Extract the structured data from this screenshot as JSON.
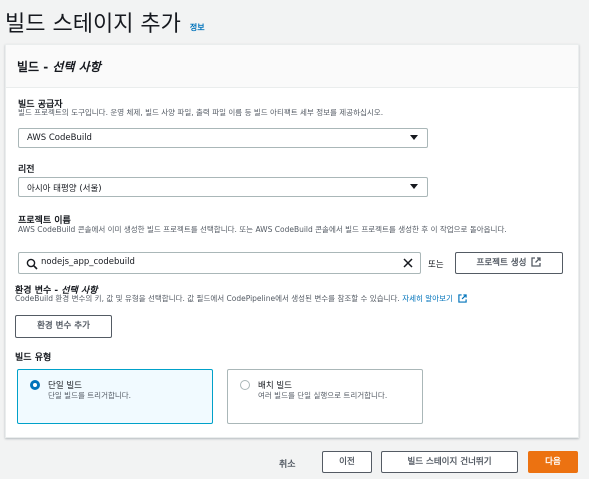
{
  "page": {
    "title": "빌드 스테이지 추가",
    "info_link": "정보"
  },
  "panel": {
    "heading": "빌드 - ",
    "heading_optional": "선택 사항"
  },
  "build_provider": {
    "label": "빌드 공급자",
    "description": "빌드 프로젝트의 도구입니다. 운영 체제, 빌드 사양 파일, 출력 파일 이름 등 빌드 아티팩트 세부 정보를 제공하십시오.",
    "value": "AWS CodeBuild"
  },
  "region": {
    "label": "리전",
    "value": "아시아 태평양 (서울)"
  },
  "project_name": {
    "label": "프로젝트 이름",
    "description": "AWS CodeBuild 콘솔에서 이미 생성한 빌드 프로젝트를 선택합니다. 또는 AWS CodeBuild 콘솔에서 빌드 프로젝트를 생성한 후 이 작업으로 돌아옵니다.",
    "value": "nodejs_app_codebuild",
    "or_text": "또는",
    "create_button": "프로젝트 생성"
  },
  "env_vars": {
    "label": "환경 변수 - ",
    "label_optional": "선택 사항",
    "description": "CodeBuild 환경 변수의 키, 값 및 유형을 선택합니다. 값 필드에서 CodePipeline에서 생성된 변수를 참조할 수 있습니다. ",
    "learn_more": "자세히 알아보기",
    "add_button": "환경 변수 추가"
  },
  "build_type": {
    "label": "빌드 유형",
    "options": [
      {
        "title": "단일 빌드",
        "description": "단일 빌드를 트리거합니다.",
        "selected": true
      },
      {
        "title": "배치 빌드",
        "description": "여러 빌드를 단일 실행으로 트리거합니다.",
        "selected": false
      }
    ]
  },
  "footer": {
    "cancel": "취소",
    "previous": "이전",
    "skip": "빌드 스테이지 건너뛰기",
    "next": "다음"
  },
  "colors": {
    "primary_button": "#ec7211",
    "link": "#0073bb",
    "selected_border": "#00a1c9",
    "selected_bg": "#f1faff"
  },
  "icons": {
    "search": "search-icon",
    "clear": "close-icon",
    "external": "external-link-icon",
    "dropdown": "caret-down-icon"
  }
}
